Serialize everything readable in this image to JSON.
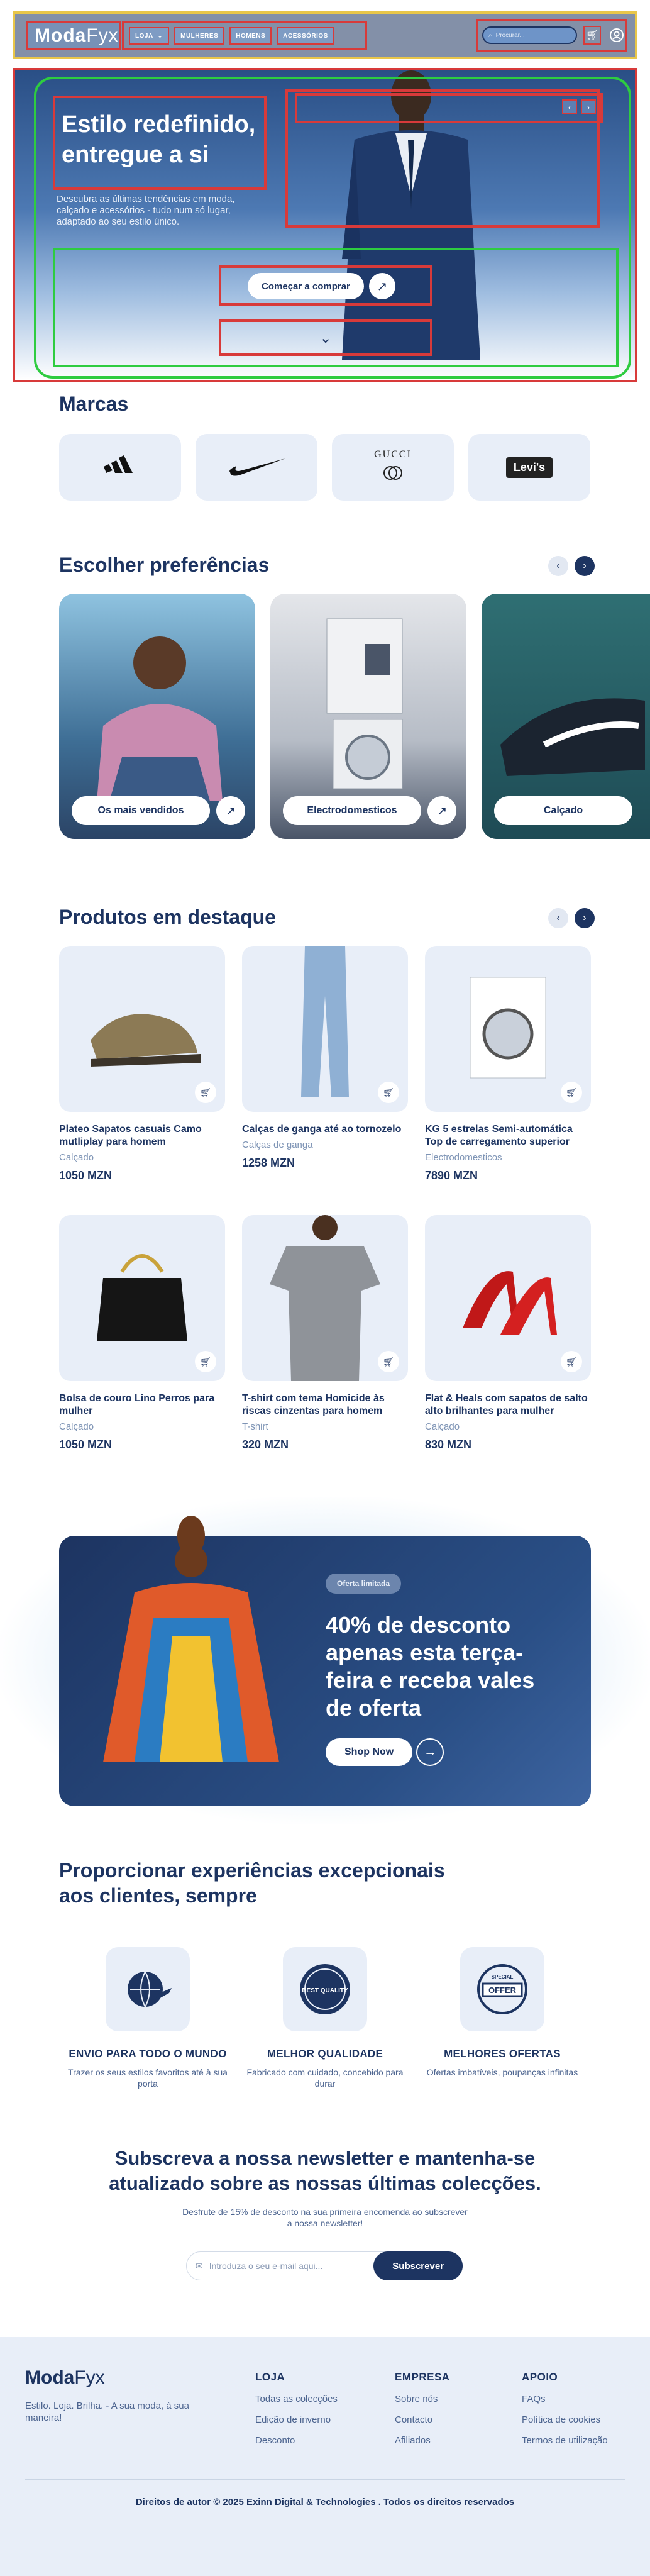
{
  "header": {
    "logo_main": "Moda",
    "logo_sub": "Fyx",
    "nav": [
      "LOJA",
      "MULHERES",
      "HOMENS",
      "ACESSÓRIOS"
    ],
    "search_placeholder": "Procurar..."
  },
  "hero": {
    "title": "Estilo redefinido, entregue a si",
    "subtitle": "Descubra as últimas tendências em moda, calçado e acessórios - tudo num só lugar, adaptado ao seu estilo único.",
    "cta": "Começar a comprar"
  },
  "brands": {
    "heading": "Marcas",
    "items": [
      "adidas",
      "Nike",
      "GUCCI",
      "Levi's"
    ]
  },
  "preferences": {
    "heading": "Escolher preferências",
    "cards": [
      "Os mais vendidos",
      "Electrodomesticos",
      "Calçado"
    ]
  },
  "products": {
    "heading": "Produtos em destaque",
    "items": [
      {
        "name": "Plateo Sapatos casuais Camo mutliplay para homem",
        "category": "Calçado",
        "price": "1050 MZN"
      },
      {
        "name": "Calças de ganga até ao tornozelo",
        "category": "Calças de ganga",
        "price": "1258 MZN"
      },
      {
        "name": "KG 5 estrelas Semi-automática Top de carregamento superior",
        "category": "Electrodomesticos",
        "price": "7890 MZN"
      },
      {
        "name": "Bolsa de couro Lino Perros para mulher",
        "category": "Calçado",
        "price": "1050 MZN"
      },
      {
        "name": "T-shirt com tema Homicide às riscas cinzentas para homem",
        "category": "T-shirt",
        "price": "320 MZN"
      },
      {
        "name": "Flat & Heals com sapatos de salto alto brilhantes para mulher",
        "category": "Calçado",
        "price": "830 MZN"
      }
    ]
  },
  "promo": {
    "badge": "Oferta limitada",
    "text": "40% de desconto apenas esta terça-feira e receba vales de oferta",
    "button": "Shop Now"
  },
  "experience": {
    "heading": "Proporcionar experiências excepcionais aos clientes, sempre",
    "features": [
      {
        "title": "ENVIO PARA TODO O MUNDO",
        "desc": "Trazer os seus estilos favoritos até à sua porta"
      },
      {
        "title": "MELHOR QUALIDADE",
        "desc": "Fabricado com cuidado, concebido para durar"
      },
      {
        "title": "MELHORES OFERTAS",
        "desc": "Ofertas imbatíveis, poupanças infinitas"
      }
    ],
    "badge_quality": "BEST QUALITY",
    "badge_offer": "OFFER",
    "badge_special": "SPECIAL"
  },
  "newsletter": {
    "heading": "Subscreva a nossa newsletter e mantenha-se atualizado sobre as nossas últimas colecções.",
    "sub": "Desfrute de 15% de desconto na sua primeira encomenda ao subscrever a nossa newsletter!",
    "placeholder": "Introduza o seu e-mail aqui...",
    "button": "Subscrever"
  },
  "footer": {
    "logo_main": "Moda",
    "logo_sub": "Fyx",
    "tagline": "Estilo. Loja. Brilha. - A sua moda, à sua maneira!",
    "columns": [
      {
        "title": "LOJA",
        "links": [
          "Todas as colecções",
          "Edição de inverno",
          "Desconto"
        ]
      },
      {
        "title": "EMPRESA",
        "links": [
          "Sobre nós",
          "Contacto",
          "Afiliados"
        ]
      },
      {
        "title": "APOIO",
        "links": [
          "FAQs",
          "Política de cookies",
          "Termos de utilização"
        ]
      }
    ],
    "copyright": "Direitos de autor © 2025 Exinn Digital & Technologies . Todos os direitos reservados"
  }
}
